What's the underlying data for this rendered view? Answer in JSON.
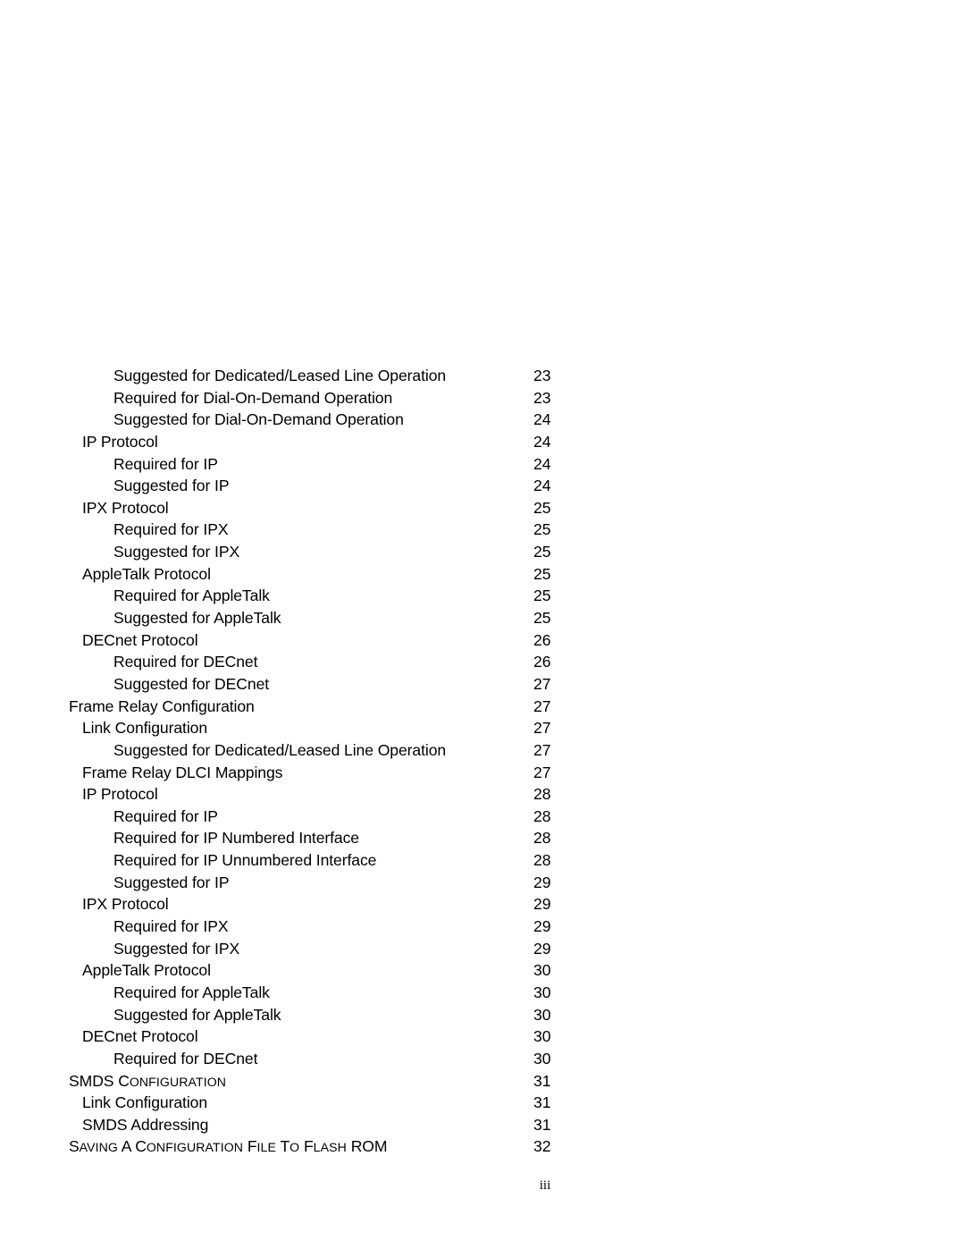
{
  "document": {
    "type": "table-of-contents",
    "folio": "iii"
  },
  "toc": {
    "entries": [
      {
        "level": 2,
        "title": "Suggested for Dedicated/Leased Line Operation",
        "page": "23",
        "smallcaps": false
      },
      {
        "level": 2,
        "title": "Required for Dial-On-Demand Operation",
        "page": "23",
        "smallcaps": false
      },
      {
        "level": 2,
        "title": "Suggested for Dial-On-Demand Operation",
        "page": "24",
        "smallcaps": false
      },
      {
        "level": 1,
        "title": "IP Protocol",
        "page": "24",
        "smallcaps": false
      },
      {
        "level": 2,
        "title": "Required for IP",
        "page": "24",
        "smallcaps": false
      },
      {
        "level": 2,
        "title": "Suggested for IP",
        "page": "24",
        "smallcaps": false
      },
      {
        "level": 1,
        "title": "IPX Protocol",
        "page": "25",
        "smallcaps": false
      },
      {
        "level": 2,
        "title": "Required for IPX",
        "page": "25",
        "smallcaps": false
      },
      {
        "level": 2,
        "title": "Suggested for IPX",
        "page": "25",
        "smallcaps": false
      },
      {
        "level": 1,
        "title": "AppleTalk Protocol",
        "page": "25",
        "smallcaps": false
      },
      {
        "level": 2,
        "title": "Required for AppleTalk",
        "page": "25",
        "smallcaps": false
      },
      {
        "level": 2,
        "title": "Suggested for AppleTalk",
        "page": "25",
        "smallcaps": false
      },
      {
        "level": 1,
        "title": "DECnet Protocol",
        "page": "26",
        "smallcaps": false
      },
      {
        "level": 2,
        "title": "Required for DECnet",
        "page": "26",
        "smallcaps": false
      },
      {
        "level": 2,
        "title": "Suggested for DECnet",
        "page": "27",
        "smallcaps": false
      },
      {
        "level": 0,
        "title": "Frame Relay Configuration",
        "page": "27",
        "smallcaps": false
      },
      {
        "level": 1,
        "title": "Link Configuration",
        "page": "27",
        "smallcaps": false
      },
      {
        "level": 2,
        "title": "Suggested for Dedicated/Leased Line Operation",
        "page": "27",
        "smallcaps": false
      },
      {
        "level": 1,
        "title": "Frame Relay DLCI Mappings",
        "page": "27",
        "smallcaps": false
      },
      {
        "level": 1,
        "title": "IP Protocol",
        "page": "28",
        "smallcaps": false
      },
      {
        "level": 2,
        "title": "Required for IP",
        "page": "28",
        "smallcaps": false
      },
      {
        "level": 2,
        "title": "Required for IP Numbered Interface",
        "page": "28",
        "smallcaps": false
      },
      {
        "level": 2,
        "title": "Required for IP Unnumbered Interface",
        "page": "28",
        "smallcaps": false
      },
      {
        "level": 2,
        "title": "Suggested for IP",
        "page": "29",
        "smallcaps": false
      },
      {
        "level": 1,
        "title": "IPX Protocol",
        "page": "29",
        "smallcaps": false
      },
      {
        "level": 2,
        "title": "Required for IPX",
        "page": "29",
        "smallcaps": false
      },
      {
        "level": 2,
        "title": "Suggested for IPX",
        "page": "29",
        "smallcaps": false
      },
      {
        "level": 1,
        "title": "AppleTalk Protocol",
        "page": "30",
        "smallcaps": false
      },
      {
        "level": 2,
        "title": "Required for AppleTalk",
        "page": "30",
        "smallcaps": false
      },
      {
        "level": 2,
        "title": "Suggested for AppleTalk",
        "page": "30",
        "smallcaps": false
      },
      {
        "level": 1,
        "title": "DECnet Protocol",
        "page": "30",
        "smallcaps": false
      },
      {
        "level": 2,
        "title": "Required for DECnet",
        "page": "30",
        "smallcaps": false
      },
      {
        "level": -1,
        "title": "SMDS Configuration",
        "page": "31",
        "smallcaps": true
      },
      {
        "level": 1,
        "title": "Link Configuration",
        "page": "31",
        "smallcaps": false
      },
      {
        "level": 1,
        "title": "SMDS Addressing",
        "page": "31",
        "smallcaps": false
      },
      {
        "level": -1,
        "title": "Saving a Configuration File to Flash ROM",
        "page": "32",
        "smallcaps": true
      }
    ]
  }
}
